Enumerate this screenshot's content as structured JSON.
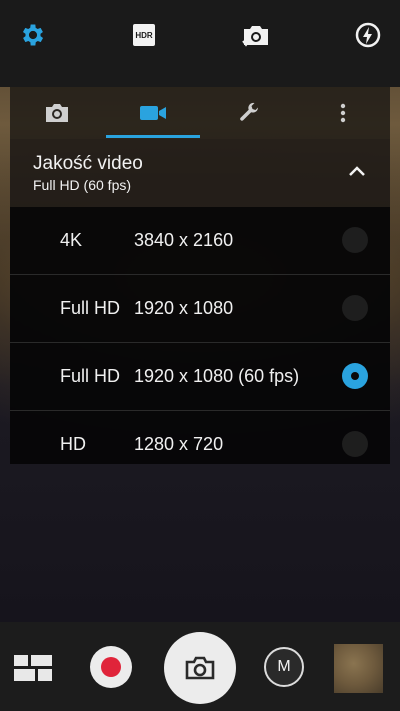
{
  "topbar": {
    "icons": [
      "settings-gear-icon",
      "hdr-icon",
      "switch-camera-icon",
      "flash-auto-icon"
    ],
    "hdr_label": "HDR",
    "accent": "#2aa3df"
  },
  "tabs": [
    {
      "icon": "camera-icon",
      "selected": false
    },
    {
      "icon": "video-camera-icon",
      "selected": true
    },
    {
      "icon": "wrench-icon",
      "selected": false
    },
    {
      "icon": "more-vert-icon",
      "selected": false
    }
  ],
  "section": {
    "title": "Jakość video",
    "subtitle": "Full HD (60 fps)"
  },
  "options": [
    {
      "name": "4K",
      "resolution": "3840 x 2160",
      "selected": false
    },
    {
      "name": "Full HD",
      "resolution": "1920 x 1080",
      "selected": false
    },
    {
      "name": "Full HD",
      "resolution": "1920 x 1080 (60 fps)",
      "selected": true
    },
    {
      "name": "HD",
      "resolution": "1280 x 720",
      "selected": false
    }
  ],
  "bottombar": {
    "mode_label": "M",
    "record_color": "#e0243a"
  }
}
